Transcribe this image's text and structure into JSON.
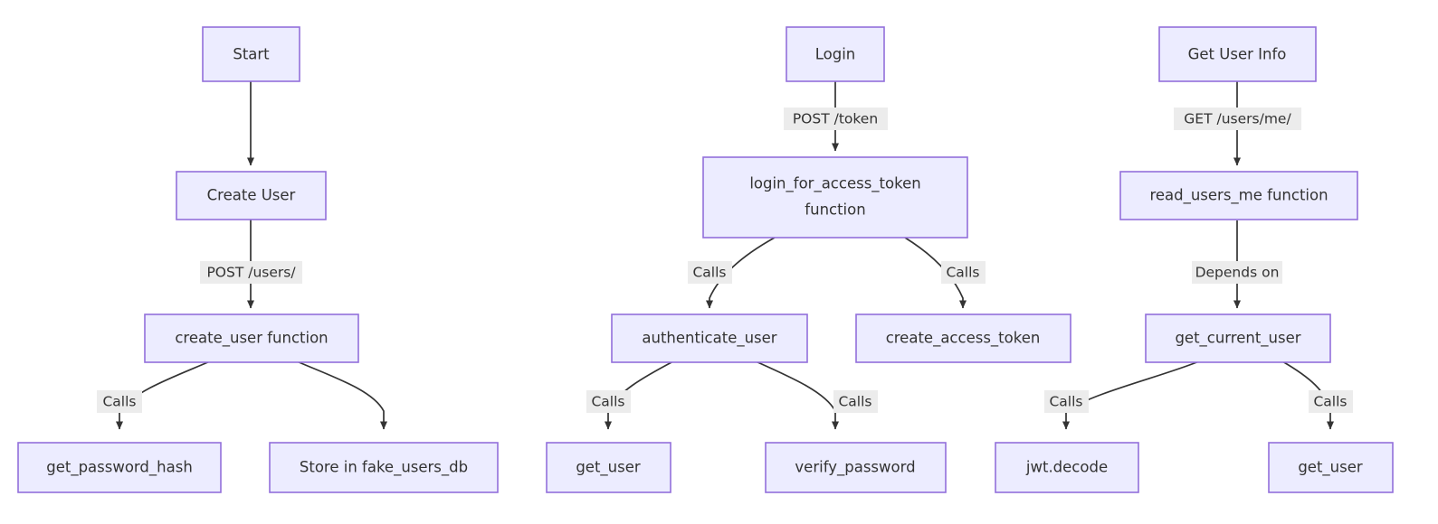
{
  "diagram": {
    "type": "flowchart",
    "direction": "top-down",
    "theme": {
      "node_fill": "#ECECFF",
      "node_stroke": "#9370DB",
      "edge_stroke": "#333333",
      "label_background": "#ECECEC",
      "text_color": "#333333",
      "canvas_background": "#FFFFFF"
    },
    "flows": [
      {
        "name": "create-user-flow",
        "nodes": [
          {
            "id": "start",
            "label": "Start"
          },
          {
            "id": "create_user",
            "label": "Create User"
          },
          {
            "id": "create_user_function",
            "label": "create_user function"
          },
          {
            "id": "get_password_hash",
            "label": "get_password_hash"
          },
          {
            "id": "store_fake_users_db",
            "label": "Store in fake_users_db"
          }
        ],
        "edges": [
          {
            "from": "start",
            "to": "create_user",
            "label": ""
          },
          {
            "from": "create_user",
            "to": "create_user_function",
            "label": "POST /users/"
          },
          {
            "from": "create_user_function",
            "to": "get_password_hash",
            "label": "Calls"
          },
          {
            "from": "create_user_function",
            "to": "store_fake_users_db",
            "label": ""
          }
        ]
      },
      {
        "name": "login-flow",
        "nodes": [
          {
            "id": "login",
            "label": "Login"
          },
          {
            "id": "login_for_access_token",
            "label_line1": "login_for_access_token",
            "label_line2": "function"
          },
          {
            "id": "authenticate_user",
            "label": "authenticate_user"
          },
          {
            "id": "create_access_token",
            "label": "create_access_token"
          },
          {
            "id": "get_user_login",
            "label": "get_user"
          },
          {
            "id": "verify_password",
            "label": "verify_password"
          }
        ],
        "edges": [
          {
            "from": "login",
            "to": "login_for_access_token",
            "label": "POST /token"
          },
          {
            "from": "login_for_access_token",
            "to": "authenticate_user",
            "label": "Calls"
          },
          {
            "from": "login_for_access_token",
            "to": "create_access_token",
            "label": "Calls"
          },
          {
            "from": "authenticate_user",
            "to": "get_user_login",
            "label": "Calls"
          },
          {
            "from": "authenticate_user",
            "to": "verify_password",
            "label": "Calls"
          }
        ]
      },
      {
        "name": "get-user-info-flow",
        "nodes": [
          {
            "id": "get_user_info",
            "label": "Get User Info"
          },
          {
            "id": "read_users_me_function",
            "label": "read_users_me function"
          },
          {
            "id": "get_current_user",
            "label": "get_current_user"
          },
          {
            "id": "jwt_decode",
            "label": "jwt.decode"
          },
          {
            "id": "get_user_info_leaf",
            "label": "get_user"
          }
        ],
        "edges": [
          {
            "from": "get_user_info",
            "to": "read_users_me_function",
            "label": "GET /users/me/"
          },
          {
            "from": "read_users_me_function",
            "to": "get_current_user",
            "label": "Depends on"
          },
          {
            "from": "get_current_user",
            "to": "jwt_decode",
            "label": "Calls"
          },
          {
            "from": "get_current_user",
            "to": "get_user_info_leaf",
            "label": "Calls"
          }
        ]
      }
    ]
  }
}
